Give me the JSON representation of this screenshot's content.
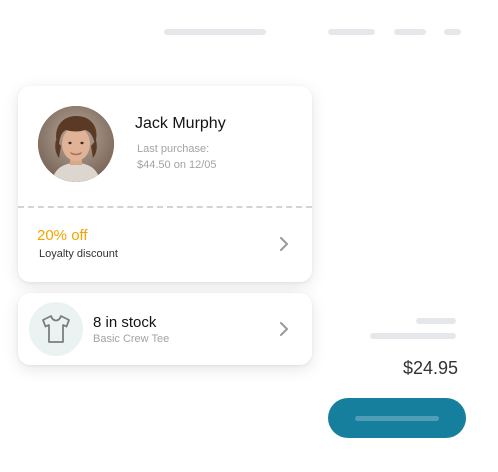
{
  "customer": {
    "name": "Jack Murphy",
    "last_purchase_label": "Last purchase:",
    "last_purchase_detail": "$44.50 on 12/05",
    "avatar_icon": "customer-portrait"
  },
  "discount": {
    "title": "20% off",
    "subtitle": "Loyalty discount",
    "color": "#f4a300",
    "chevron_icon": "chevron-right-icon"
  },
  "product": {
    "title": "8 in stock",
    "subtitle": "Basic Crew Tee",
    "icon": "t-shirt-icon",
    "chevron_icon": "chevron-right-icon"
  },
  "summary": {
    "price": "$24.95"
  },
  "colors": {
    "accent": "#167f9e",
    "discount": "#f4a300",
    "product_icon_bg": "#eaf3f2"
  }
}
